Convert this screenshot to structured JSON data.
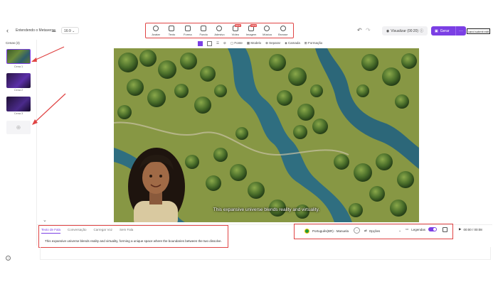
{
  "header": {
    "project_title": "Entendendo o Metaverso",
    "ratio": "16:9",
    "visualizar_label": "Visualizar (00:20)",
    "gerar_label": "Gerar",
    "submit_tag": "cand submit edit"
  },
  "toolbar": {
    "items": [
      {
        "label": "Avatar",
        "icon": "avatar-icon"
      },
      {
        "label": "Texto",
        "icon": "text-icon"
      },
      {
        "label": "Forma",
        "icon": "shape-icon"
      },
      {
        "label": "Fundo",
        "icon": "background-icon"
      },
      {
        "label": "Adesivo",
        "icon": "sticker-icon"
      },
      {
        "label": "Vídeo",
        "icon": "video-icon",
        "badge": "NEW"
      },
      {
        "label": "Imagem",
        "icon": "image-icon",
        "badge": "NEW"
      },
      {
        "label": "Música",
        "icon": "music-icon"
      },
      {
        "label": "Browse",
        "icon": "browse-icon"
      }
    ]
  },
  "subtoolbar": {
    "fonte": "Fonte",
    "modelo": "Modelo",
    "separar": "Separar",
    "camada": "Camada",
    "formacao": "Formação"
  },
  "sidebar": {
    "title": "Cenas (3)",
    "scenes": [
      {
        "label": "Cena 1"
      },
      {
        "label": "Cena 2"
      },
      {
        "label": "Cena 3"
      }
    ]
  },
  "canvas": {
    "caption": "This expansive universe blends reality and virtuality."
  },
  "bottom": {
    "tabs": [
      "Texto de Fala",
      "Conversação",
      "Carregar Voz",
      "Sem Fala"
    ],
    "active_tab": 0,
    "script": "This expansive universe blends reality and virtuality, forming a unique space where the boundaries between the two dissolve.",
    "voice": "Português(BR) - Manuela",
    "options_label": "Opções",
    "legendas_label": "Legendas",
    "time": "00:00 / 00:08"
  },
  "colors": {
    "accent": "#7b3fe4",
    "annotation": "#e04444"
  }
}
